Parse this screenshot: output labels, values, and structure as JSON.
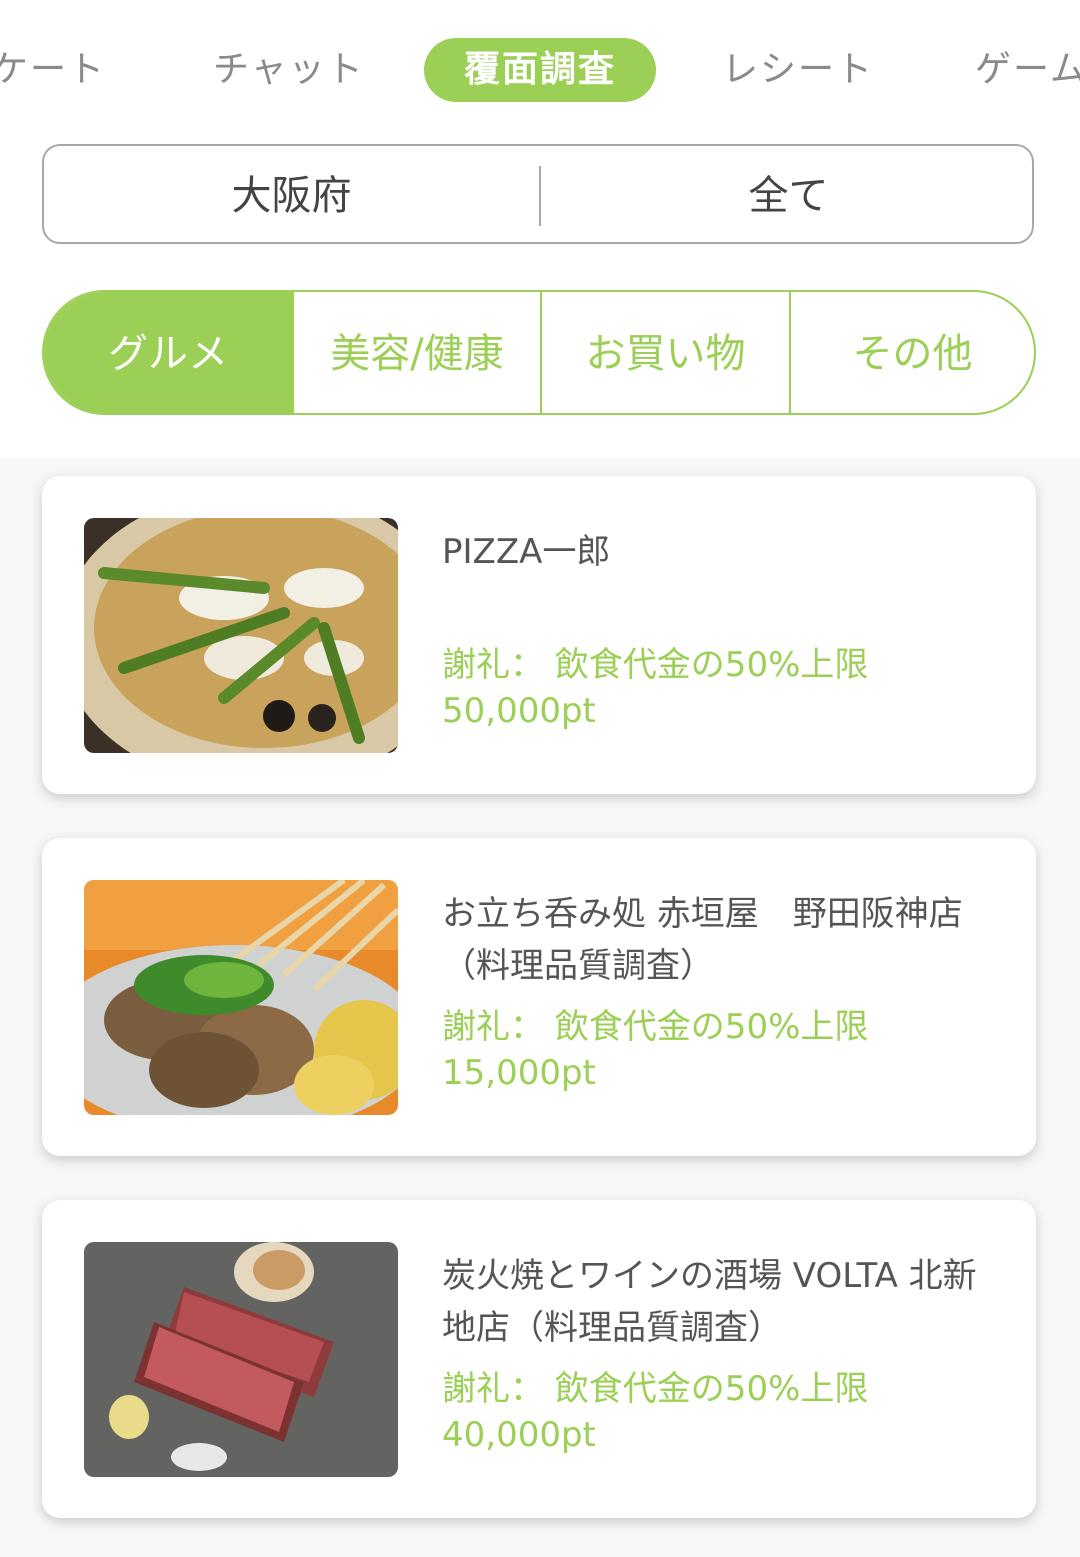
{
  "tabs": [
    {
      "label": "ケート"
    },
    {
      "label": "チャット"
    },
    {
      "label": "覆面調査"
    },
    {
      "label": "レシート"
    },
    {
      "label": "ゲーム"
    }
  ],
  "filter": {
    "region": "大阪府",
    "area": "全て"
  },
  "categories": [
    {
      "label": "グルメ"
    },
    {
      "label": "美容/健康"
    },
    {
      "label": "お買い物"
    },
    {
      "label": "その他"
    }
  ],
  "cards": [
    {
      "name": "PIZZA一郎",
      "reward_label": "謝礼： 飲食代金の50%上限",
      "points": "50,000pt"
    },
    {
      "name": "お立ち呑み処 赤垣屋　野田阪神店（料理品質調査）",
      "reward_label": "謝礼： 飲食代金の50%上限",
      "points": "15,000pt"
    },
    {
      "name": "炭火焼とワインの酒場 VOLTA 北新地店（料理品質調査）",
      "reward_label": "謝礼： 飲食代金の50%上限",
      "points": "40,000pt"
    }
  ],
  "colors": {
    "accent": "#9ccf56",
    "text": "#555555",
    "muted": "#8a8a8a"
  }
}
